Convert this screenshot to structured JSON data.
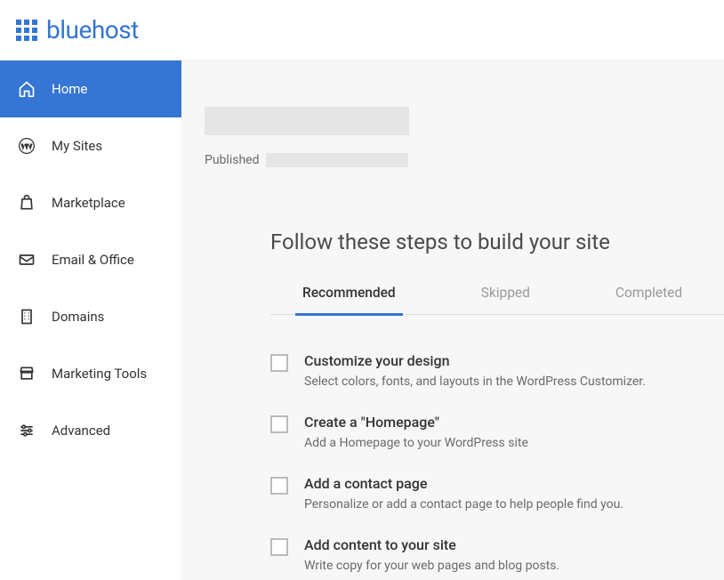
{
  "brand": "bluehost",
  "sidebar": {
    "items": [
      {
        "label": "Home",
        "icon": "home-icon",
        "active": true
      },
      {
        "label": "My Sites",
        "icon": "wordpress-icon",
        "active": false
      },
      {
        "label": "Marketplace",
        "icon": "bag-icon",
        "active": false
      },
      {
        "label": "Email & Office",
        "icon": "mail-icon",
        "active": false
      },
      {
        "label": "Domains",
        "icon": "building-icon",
        "active": false
      },
      {
        "label": "Marketing Tools",
        "icon": "storefront-icon",
        "active": false
      },
      {
        "label": "Advanced",
        "icon": "sliders-icon",
        "active": false
      }
    ]
  },
  "site": {
    "status_label": "Published"
  },
  "steps": {
    "heading": "Follow these steps to build your site",
    "tabs": [
      {
        "label": "Recommended",
        "active": true
      },
      {
        "label": "Skipped",
        "active": false
      },
      {
        "label": "Completed",
        "active": false
      }
    ],
    "tasks": [
      {
        "title": "Customize your design",
        "desc": "Select colors, fonts, and layouts in the WordPress Customizer."
      },
      {
        "title": "Create a \"Homepage\"",
        "desc": "Add a Homepage to your WordPress site"
      },
      {
        "title": "Add a contact page",
        "desc": "Personalize or add a contact page to help people find you."
      },
      {
        "title": "Add content to your site",
        "desc": "Write copy for your web pages and blog posts."
      }
    ]
  }
}
